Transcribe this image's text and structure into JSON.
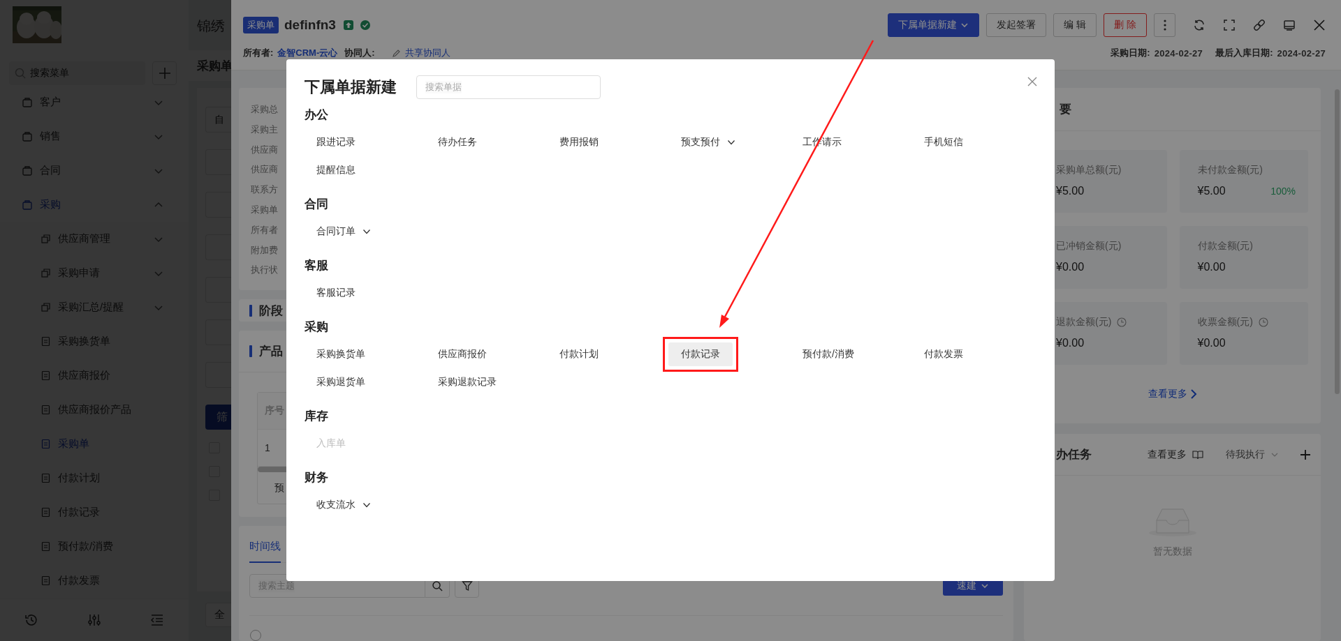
{
  "sidebar": {
    "search": {
      "placeholder": "搜索菜单"
    },
    "menu": [
      {
        "label": "客户",
        "expanded": false,
        "selected": false
      },
      {
        "label": "销售",
        "expanded": false,
        "selected": false
      },
      {
        "label": "合同",
        "expanded": false,
        "selected": false
      },
      {
        "label": "采购",
        "expanded": true,
        "selected": true,
        "children": [
          {
            "label": "供应商管理",
            "expandable": true,
            "selected": false
          },
          {
            "label": "采购申请",
            "expandable": true,
            "selected": false
          },
          {
            "label": "采购汇总/提醒",
            "expandable": true,
            "selected": false
          },
          {
            "label": "采购换货单",
            "expandable": false,
            "selected": false
          },
          {
            "label": "供应商报价",
            "expandable": false,
            "selected": false
          },
          {
            "label": "供应商报价产品",
            "expandable": false,
            "selected": false
          },
          {
            "label": "采购单",
            "expandable": false,
            "selected": true
          },
          {
            "label": "付款计划",
            "expandable": false,
            "selected": false
          },
          {
            "label": "付款记录",
            "expandable": false,
            "selected": false
          },
          {
            "label": "预付款/消费",
            "expandable": false,
            "selected": false
          },
          {
            "label": "付款发票",
            "expandable": false,
            "selected": false
          }
        ]
      }
    ]
  },
  "list_page": {
    "title": "锦绣",
    "heading": "采购单",
    "filter_placeholder": "自",
    "filter_button": "筛",
    "rows": [
      {
        "checked": false
      },
      {
        "checked": false
      },
      {
        "checked": false
      }
    ],
    "footer_select": "全"
  },
  "record": {
    "badge": "采购单",
    "title": "definfn3",
    "actions": [
      {
        "label": "下属单据新建",
        "kind": "primary",
        "dropdown": true
      },
      {
        "label": "发起签署",
        "kind": "default",
        "dropdown": false
      },
      {
        "label": "编 辑",
        "kind": "default",
        "dropdown": false
      },
      {
        "label": "删 除",
        "kind": "danger",
        "dropdown": false
      }
    ],
    "owner_label": "所有者:",
    "owner": "金智CRM-云心",
    "collaborator_label": "协同人:",
    "collaborator_link": "共享协同人",
    "purchase_date_label": "采购日期:",
    "purchase_date": "2024-02-27",
    "last_inbound_label": "最后入库日期:",
    "last_inbound_date": "2024-02-27"
  },
  "info_fields": [
    "采购总",
    "采购主",
    "供应商",
    "供应商",
    "联系方",
    "采购单",
    "所有者",
    "附加费",
    "执行状"
  ],
  "stage_card": {
    "title": "阶段"
  },
  "product_card": {
    "title": "产品",
    "columns": [
      "序号"
    ],
    "rows": [
      [
        "1"
      ]
    ],
    "footer": "预"
  },
  "timeline": {
    "tabs": [
      {
        "label": "时间线",
        "selected": true
      }
    ],
    "search_placeholder": "搜索主题",
    "quick_button": "速建",
    "entries": [
      {
        "checked": false
      }
    ]
  },
  "summary": {
    "title": "要",
    "tiles": [
      {
        "label": "采购单总额(元)",
        "value": "¥5.00",
        "clock": false
      },
      {
        "label": "未付款金额(元)",
        "value": "¥5.00",
        "clock": false,
        "percent": "100%"
      },
      {
        "label": "已冲销金额(元)",
        "value": "¥0.00",
        "clock": false
      },
      {
        "label": "付款金额(元)",
        "value": "¥0.00",
        "clock": false
      },
      {
        "label": "退款金额(元)",
        "value": "¥0.00",
        "clock": true
      },
      {
        "label": "收票金额(元)",
        "value": "¥0.00",
        "clock": true
      }
    ],
    "more_link": "查看更多"
  },
  "tasks": {
    "title": "办任务",
    "more": "查看更多",
    "filter": "待我执行",
    "empty": "暂无数据"
  },
  "modal": {
    "title": "下属单据新建",
    "search_placeholder": "搜索单据",
    "groups": [
      {
        "title": "办公",
        "items": [
          {
            "label": "跟进记录",
            "dropdown": false,
            "disabled": false,
            "highlighted": false,
            "marked": false
          },
          {
            "label": "待办任务",
            "dropdown": false,
            "disabled": false,
            "highlighted": false,
            "marked": false
          },
          {
            "label": "费用报销",
            "dropdown": false,
            "disabled": false,
            "highlighted": false,
            "marked": false
          },
          {
            "label": "预支预付",
            "dropdown": true,
            "disabled": false,
            "highlighted": false,
            "marked": false
          },
          {
            "label": "工作请示",
            "dropdown": false,
            "disabled": false,
            "highlighted": false,
            "marked": false
          },
          {
            "label": "手机短信",
            "dropdown": false,
            "disabled": false,
            "highlighted": false,
            "marked": false
          },
          {
            "label": "提醒信息",
            "dropdown": false,
            "disabled": false,
            "highlighted": false,
            "marked": false
          }
        ]
      },
      {
        "title": "合同",
        "items": [
          {
            "label": "合同订单",
            "dropdown": true,
            "disabled": false,
            "highlighted": false,
            "marked": false
          }
        ]
      },
      {
        "title": "客服",
        "items": [
          {
            "label": "客服记录",
            "dropdown": false,
            "disabled": false,
            "highlighted": false,
            "marked": false
          }
        ]
      },
      {
        "title": "采购",
        "items": [
          {
            "label": "采购换货单",
            "dropdown": false,
            "disabled": false,
            "highlighted": false,
            "marked": false
          },
          {
            "label": "供应商报价",
            "dropdown": false,
            "disabled": false,
            "highlighted": false,
            "marked": false
          },
          {
            "label": "付款计划",
            "dropdown": false,
            "disabled": false,
            "highlighted": false,
            "marked": false
          },
          {
            "label": "付款记录",
            "dropdown": false,
            "disabled": false,
            "highlighted": true,
            "marked": true
          },
          {
            "label": "预付款/消费",
            "dropdown": false,
            "disabled": false,
            "highlighted": false,
            "marked": false
          },
          {
            "label": "付款发票",
            "dropdown": false,
            "disabled": false,
            "highlighted": false,
            "marked": false
          },
          {
            "label": "采购退货单",
            "dropdown": false,
            "disabled": false,
            "highlighted": false,
            "marked": false
          },
          {
            "label": "采购退款记录",
            "dropdown": false,
            "disabled": false,
            "highlighted": false,
            "marked": false
          }
        ]
      },
      {
        "title": "库存",
        "items": [
          {
            "label": "入库单",
            "dropdown": false,
            "disabled": true,
            "highlighted": false,
            "marked": false
          }
        ]
      },
      {
        "title": "财务",
        "items": [
          {
            "label": "收支流水",
            "dropdown": true,
            "disabled": false,
            "highlighted": false,
            "marked": false
          }
        ]
      }
    ]
  },
  "annotations": [
    {
      "kind": "arrow"
    }
  ]
}
